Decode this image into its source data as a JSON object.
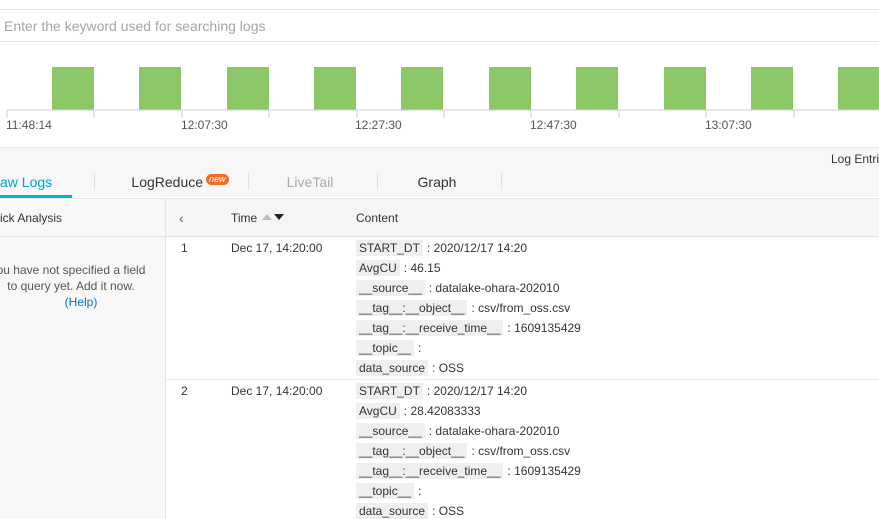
{
  "search": {
    "placeholder": "Enter the keyword used for searching logs"
  },
  "histogram": {
    "bar_color": "#8cc867",
    "tick_labels": [
      "11:48:14",
      "12:07:30",
      "12:27:30",
      "12:47:30",
      "13:07:30"
    ]
  },
  "summary": {
    "log_entries_label": "Log Entri"
  },
  "tabs": [
    {
      "label": "aw Logs",
      "active": true
    },
    {
      "label": "LogReduce",
      "badge": "new"
    },
    {
      "label": "LiveTail",
      "disabled": true
    },
    {
      "label": "Graph"
    }
  ],
  "left_panel": {
    "header": "ick Analysis",
    "message_line1": "ou have not specified a field",
    "message_line2": "to query yet. Add it now.",
    "help": "(Help)"
  },
  "table": {
    "col_time": "Time",
    "col_content": "Content",
    "rows": [
      {
        "index": "1",
        "time": "Dec 17, 14:20:00",
        "fields": [
          {
            "key": "START_DT",
            "value": "2020/12/17 14:20"
          },
          {
            "key": "AvgCU",
            "value": "46.15"
          },
          {
            "key": "__source__",
            "value": "datalake-ohara-202010"
          },
          {
            "key": "__tag__:__object__",
            "value": "csv/from_oss.csv"
          },
          {
            "key": "__tag__:__receive_time__",
            "value": "1609135429"
          },
          {
            "key": "__topic__",
            "value": ""
          },
          {
            "key": "data_source",
            "value": "OSS"
          }
        ]
      },
      {
        "index": "2",
        "time": "Dec 17, 14:20:00",
        "fields": [
          {
            "key": "START_DT",
            "value": "2020/12/17 14:20"
          },
          {
            "key": "AvgCU",
            "value": "28.42083333"
          },
          {
            "key": "__source__",
            "value": "datalake-ohara-202010"
          },
          {
            "key": "__tag__:__object__",
            "value": "csv/from_oss.csv"
          },
          {
            "key": "__tag__:__receive_time__",
            "value": "1609135429"
          },
          {
            "key": "__topic__",
            "value": ""
          },
          {
            "key": "data_source",
            "value": "OSS"
          }
        ]
      }
    ]
  }
}
